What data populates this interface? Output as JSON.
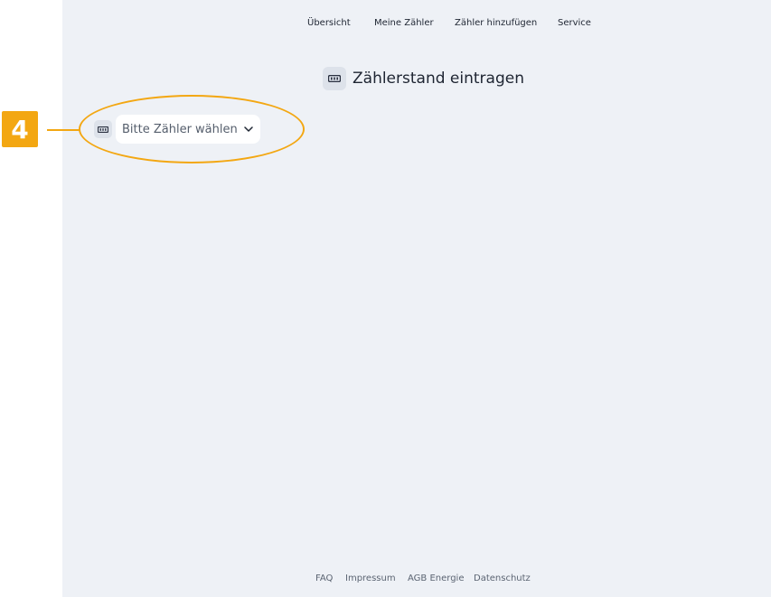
{
  "nav": {
    "items": [
      "Übersicht",
      "Meine Zähler",
      "Zähler hinzufügen",
      "Service"
    ]
  },
  "main": {
    "title": "Zählerstand eintragen",
    "title_icon": "meter-icon",
    "meter_select": {
      "icon": "meter-icon",
      "label": "Bitte Zähler wählen",
      "chevron": "chevron-down-icon"
    }
  },
  "footer": {
    "links": [
      "FAQ",
      "Impressum",
      "AGB Energie",
      "Datenschutz"
    ]
  },
  "annotation": {
    "step_number": "4",
    "color": "#f3a712"
  },
  "colors": {
    "page_background": "#eef1f6",
    "icon_background": "#dde2ea",
    "text": "#1e2532"
  }
}
